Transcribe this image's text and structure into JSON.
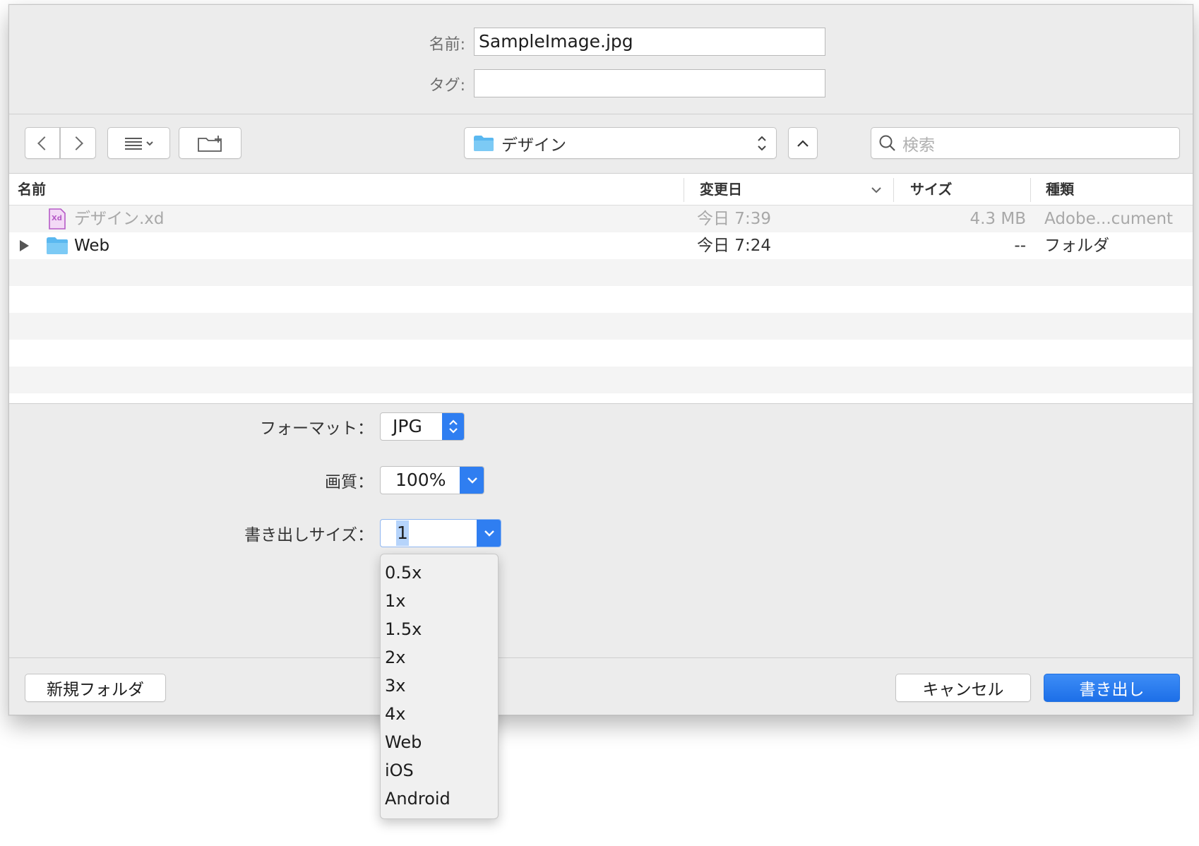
{
  "form": {
    "name_label": "名前:",
    "name_value": "SampleImage.jpg",
    "tag_label": "タグ:",
    "tag_value": ""
  },
  "toolbar": {
    "location": "デザイン",
    "search_placeholder": "検索",
    "icons": [
      "back-icon",
      "forward-icon",
      "list-view-icon",
      "new-folder-icon",
      "folder-icon",
      "up-down-icon",
      "chevron-up-icon",
      "search-icon"
    ]
  },
  "table": {
    "headers": {
      "name": "名前",
      "modified": "変更日",
      "size": "サイズ",
      "kind": "種類"
    },
    "rows": [
      {
        "name": "デザイン.xd",
        "modified": "今日 7:39",
        "size": "4.3 MB",
        "kind": "Adobe...cument",
        "dimmed": true,
        "icon": "xd-file-icon"
      },
      {
        "name": "Web",
        "modified": "今日 7:24",
        "size": "--",
        "kind": "フォルダ",
        "dimmed": false,
        "icon": "folder-icon"
      }
    ]
  },
  "options": {
    "format_label": "フォーマット：",
    "format_value": "JPG",
    "quality_label": "画質：",
    "quality_value": "100%",
    "export_size_label": "書き出しサイズ：",
    "export_size_value": "1"
  },
  "size_menu": [
    "0.5x",
    "1x",
    "1.5x",
    "2x",
    "3x",
    "4x",
    "Web",
    "iOS",
    "Android"
  ],
  "footer": {
    "new_folder": "新規フォルダ",
    "cancel": "キャンセル",
    "export": "書き出し"
  },
  "colors": {
    "accent": "#2f7ef1",
    "folder": "#5ab8f0",
    "xd": "#b65bc7"
  }
}
